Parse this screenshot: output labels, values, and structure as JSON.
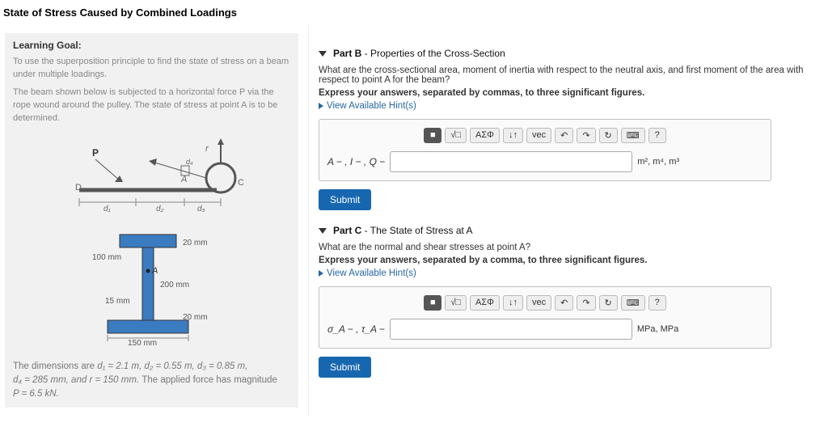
{
  "page": {
    "title": "State of Stress Caused by Combined Loadings"
  },
  "learning_goal": {
    "heading": "Learning Goal:",
    "intro": "To use the superposition principle to find the state of stress on a beam under multiple loadings.",
    "body": "The beam shown below is subjected to a horizontal force P via the rope wound around the pulley. The state of stress at point A is to be determined."
  },
  "figure": {
    "beam": {
      "P_label": "P",
      "r_label": "r",
      "D_label": "D",
      "A_label": "A",
      "C_label": "C",
      "d1": "d₁",
      "d2": "d₂",
      "d3": "d₃",
      "d4": "d₄"
    },
    "section": {
      "flange_w": "100 mm",
      "web_h_above": "20 mm",
      "web_t": "200 mm",
      "web_left": "15 mm",
      "flange_b_bot": "150 mm",
      "web_h_below": "20 mm",
      "A_label": "A"
    }
  },
  "dimensions": {
    "line1_pre": "The dimensions are ",
    "d1": "d₁ = 2.1 m, ",
    "d2": "d₂ = 0.55 m, ",
    "d3": "d₃ = 0.85 m,",
    "line2_d4": "d₄ = 285 mm, and ",
    "r": "r = 150 mm. ",
    "line2_post": "The applied force has magnitude",
    "P": "P = 6.5 kN."
  },
  "partB": {
    "title_strong": "Part B",
    "title_rest": " - Properties of the Cross-Section",
    "question": "What are the cross-sectional area, moment of inertia with respect to the neutral axis, and first moment of the area with respect to point A for the beam?",
    "instruction": "Express your answers, separated by commas, to three significant figures.",
    "hint": "View Available Hint(s)",
    "ans_label": "A − , I − , Q −",
    "units": "m², m⁴, m³",
    "toolbar": {
      "b1": "■",
      "b2": "√□",
      "b3": "ΑΣΦ",
      "b4": "↓↑",
      "b5": "vec",
      "b6": "↶",
      "b7": "↷",
      "b8": "↻",
      "b9": "⌨",
      "b10": "?"
    },
    "submit": "Submit"
  },
  "partC": {
    "title_strong": "Part C",
    "title_rest": " - The State of Stress at A",
    "question": "What are the normal and shear stresses at point A?",
    "instruction": "Express your answers, separated by a comma, to three significant figures.",
    "hint": "View Available Hint(s)",
    "ans_label": "σ_A − , τ_A −",
    "units": "MPa, MPa",
    "toolbar": {
      "b1": "■",
      "b2": "√□",
      "b3": "ΑΣΦ",
      "b4": "↓↑",
      "b5": "vec",
      "b6": "↶",
      "b7": "↷",
      "b8": "↻",
      "b9": "⌨",
      "b10": "?"
    },
    "submit": "Submit"
  }
}
